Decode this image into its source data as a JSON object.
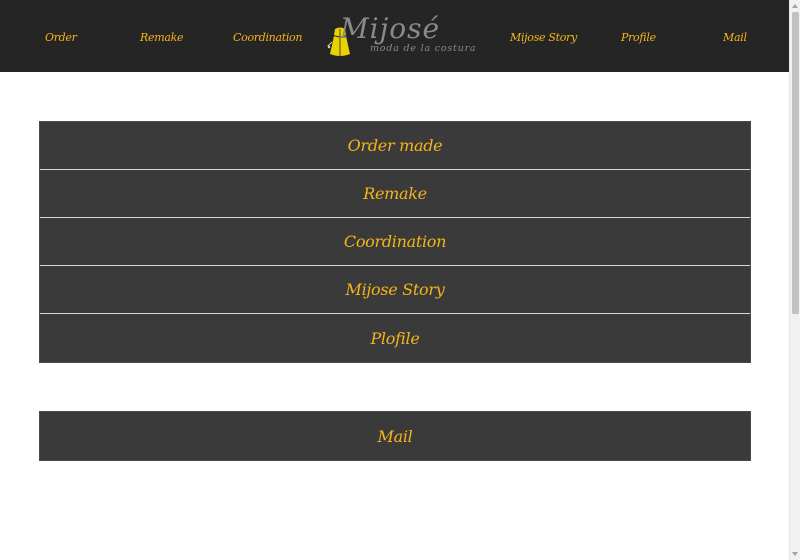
{
  "header": {
    "nav_left": [
      "Order",
      "Remake",
      "Coordination"
    ],
    "nav_right": [
      "Mijose Story",
      "Profile",
      "Mail"
    ],
    "logo": {
      "title": "Mijosé",
      "subtitle": "moda de la costura"
    }
  },
  "menu": {
    "items": [
      "Order made",
      "Remake",
      "Coordination",
      "Mijose Story",
      "Plofile"
    ]
  },
  "contact": {
    "label": "Mail"
  },
  "colors": {
    "header_bg": "#252525",
    "panel_bg": "#3a3a3a",
    "accent": "#f5b41a",
    "logo_gray": "#8a8a8a"
  }
}
